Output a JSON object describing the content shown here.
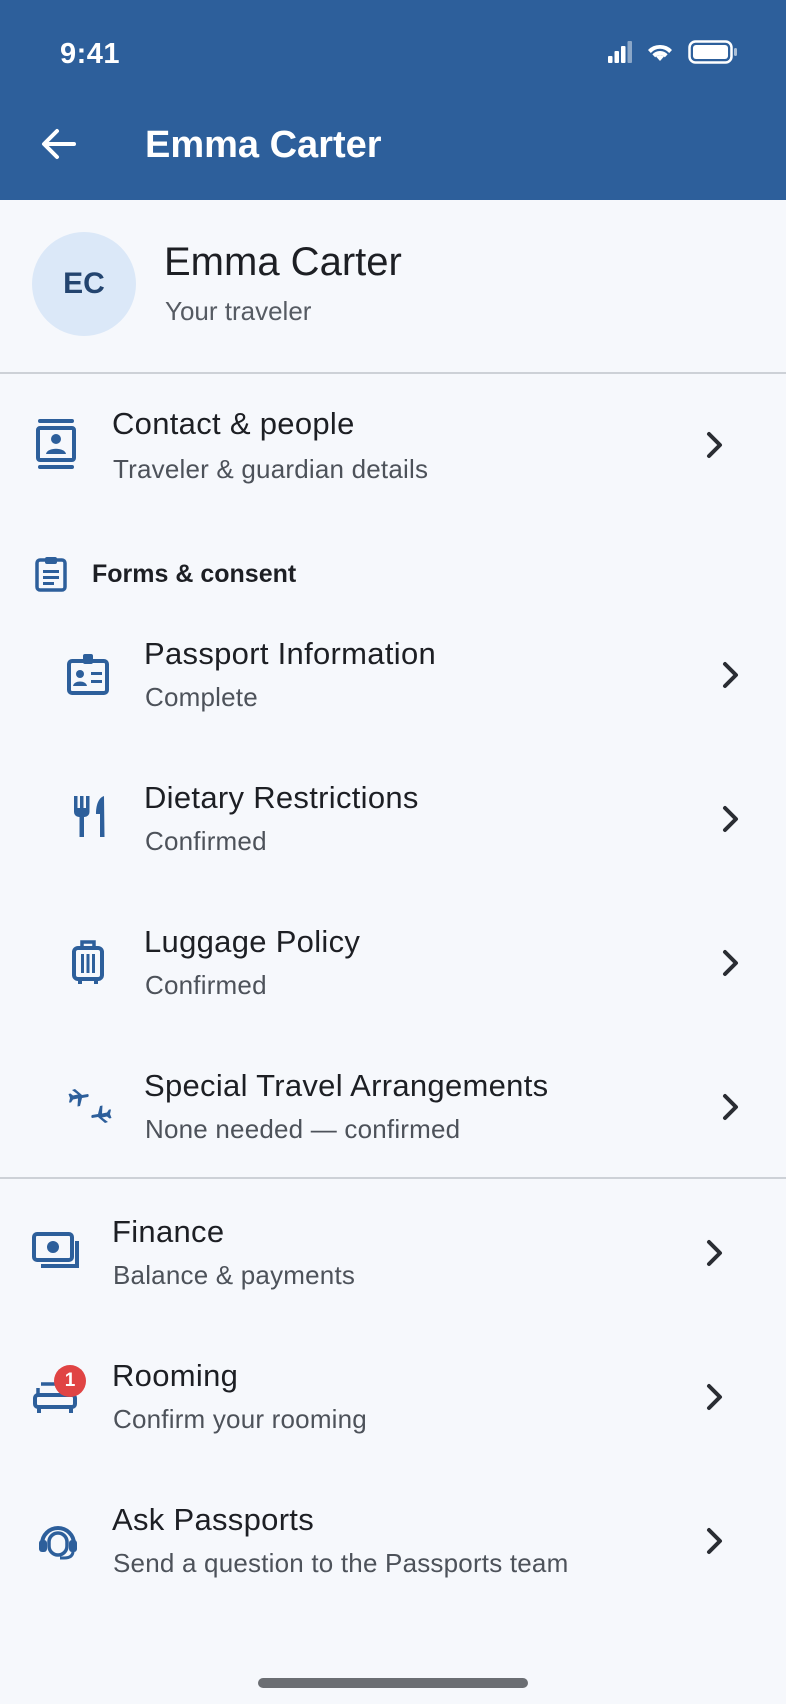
{
  "status_bar": {
    "time": "9:41"
  },
  "header": {
    "title": "Emma Carter"
  },
  "profile": {
    "initials": "EC",
    "name": "Emma Carter",
    "subtitle": "Your traveler"
  },
  "contact": {
    "title": "Contact & people",
    "subtitle": "Traveler & guardian details"
  },
  "forms_section": {
    "label": "Forms & consent"
  },
  "forms": [
    {
      "title": "Passport Information",
      "subtitle": "Complete"
    },
    {
      "title": "Dietary Restrictions",
      "subtitle": "Confirmed"
    },
    {
      "title": "Luggage Policy",
      "subtitle": "Confirmed"
    },
    {
      "title": "Special Travel Arrangements",
      "subtitle": "None needed — confirmed"
    }
  ],
  "bottom_items": [
    {
      "title": "Finance",
      "subtitle": "Balance & payments"
    },
    {
      "title": "Rooming",
      "subtitle": "Confirm your rooming",
      "badge": "1"
    },
    {
      "title": "Ask Passports",
      "subtitle": "Send a question to the Passports team"
    }
  ],
  "colors": {
    "header": "#2d5f9b",
    "icon": "#2d5f9b",
    "badge": "#e04444",
    "avatar_bg": "#dbe8f8"
  }
}
